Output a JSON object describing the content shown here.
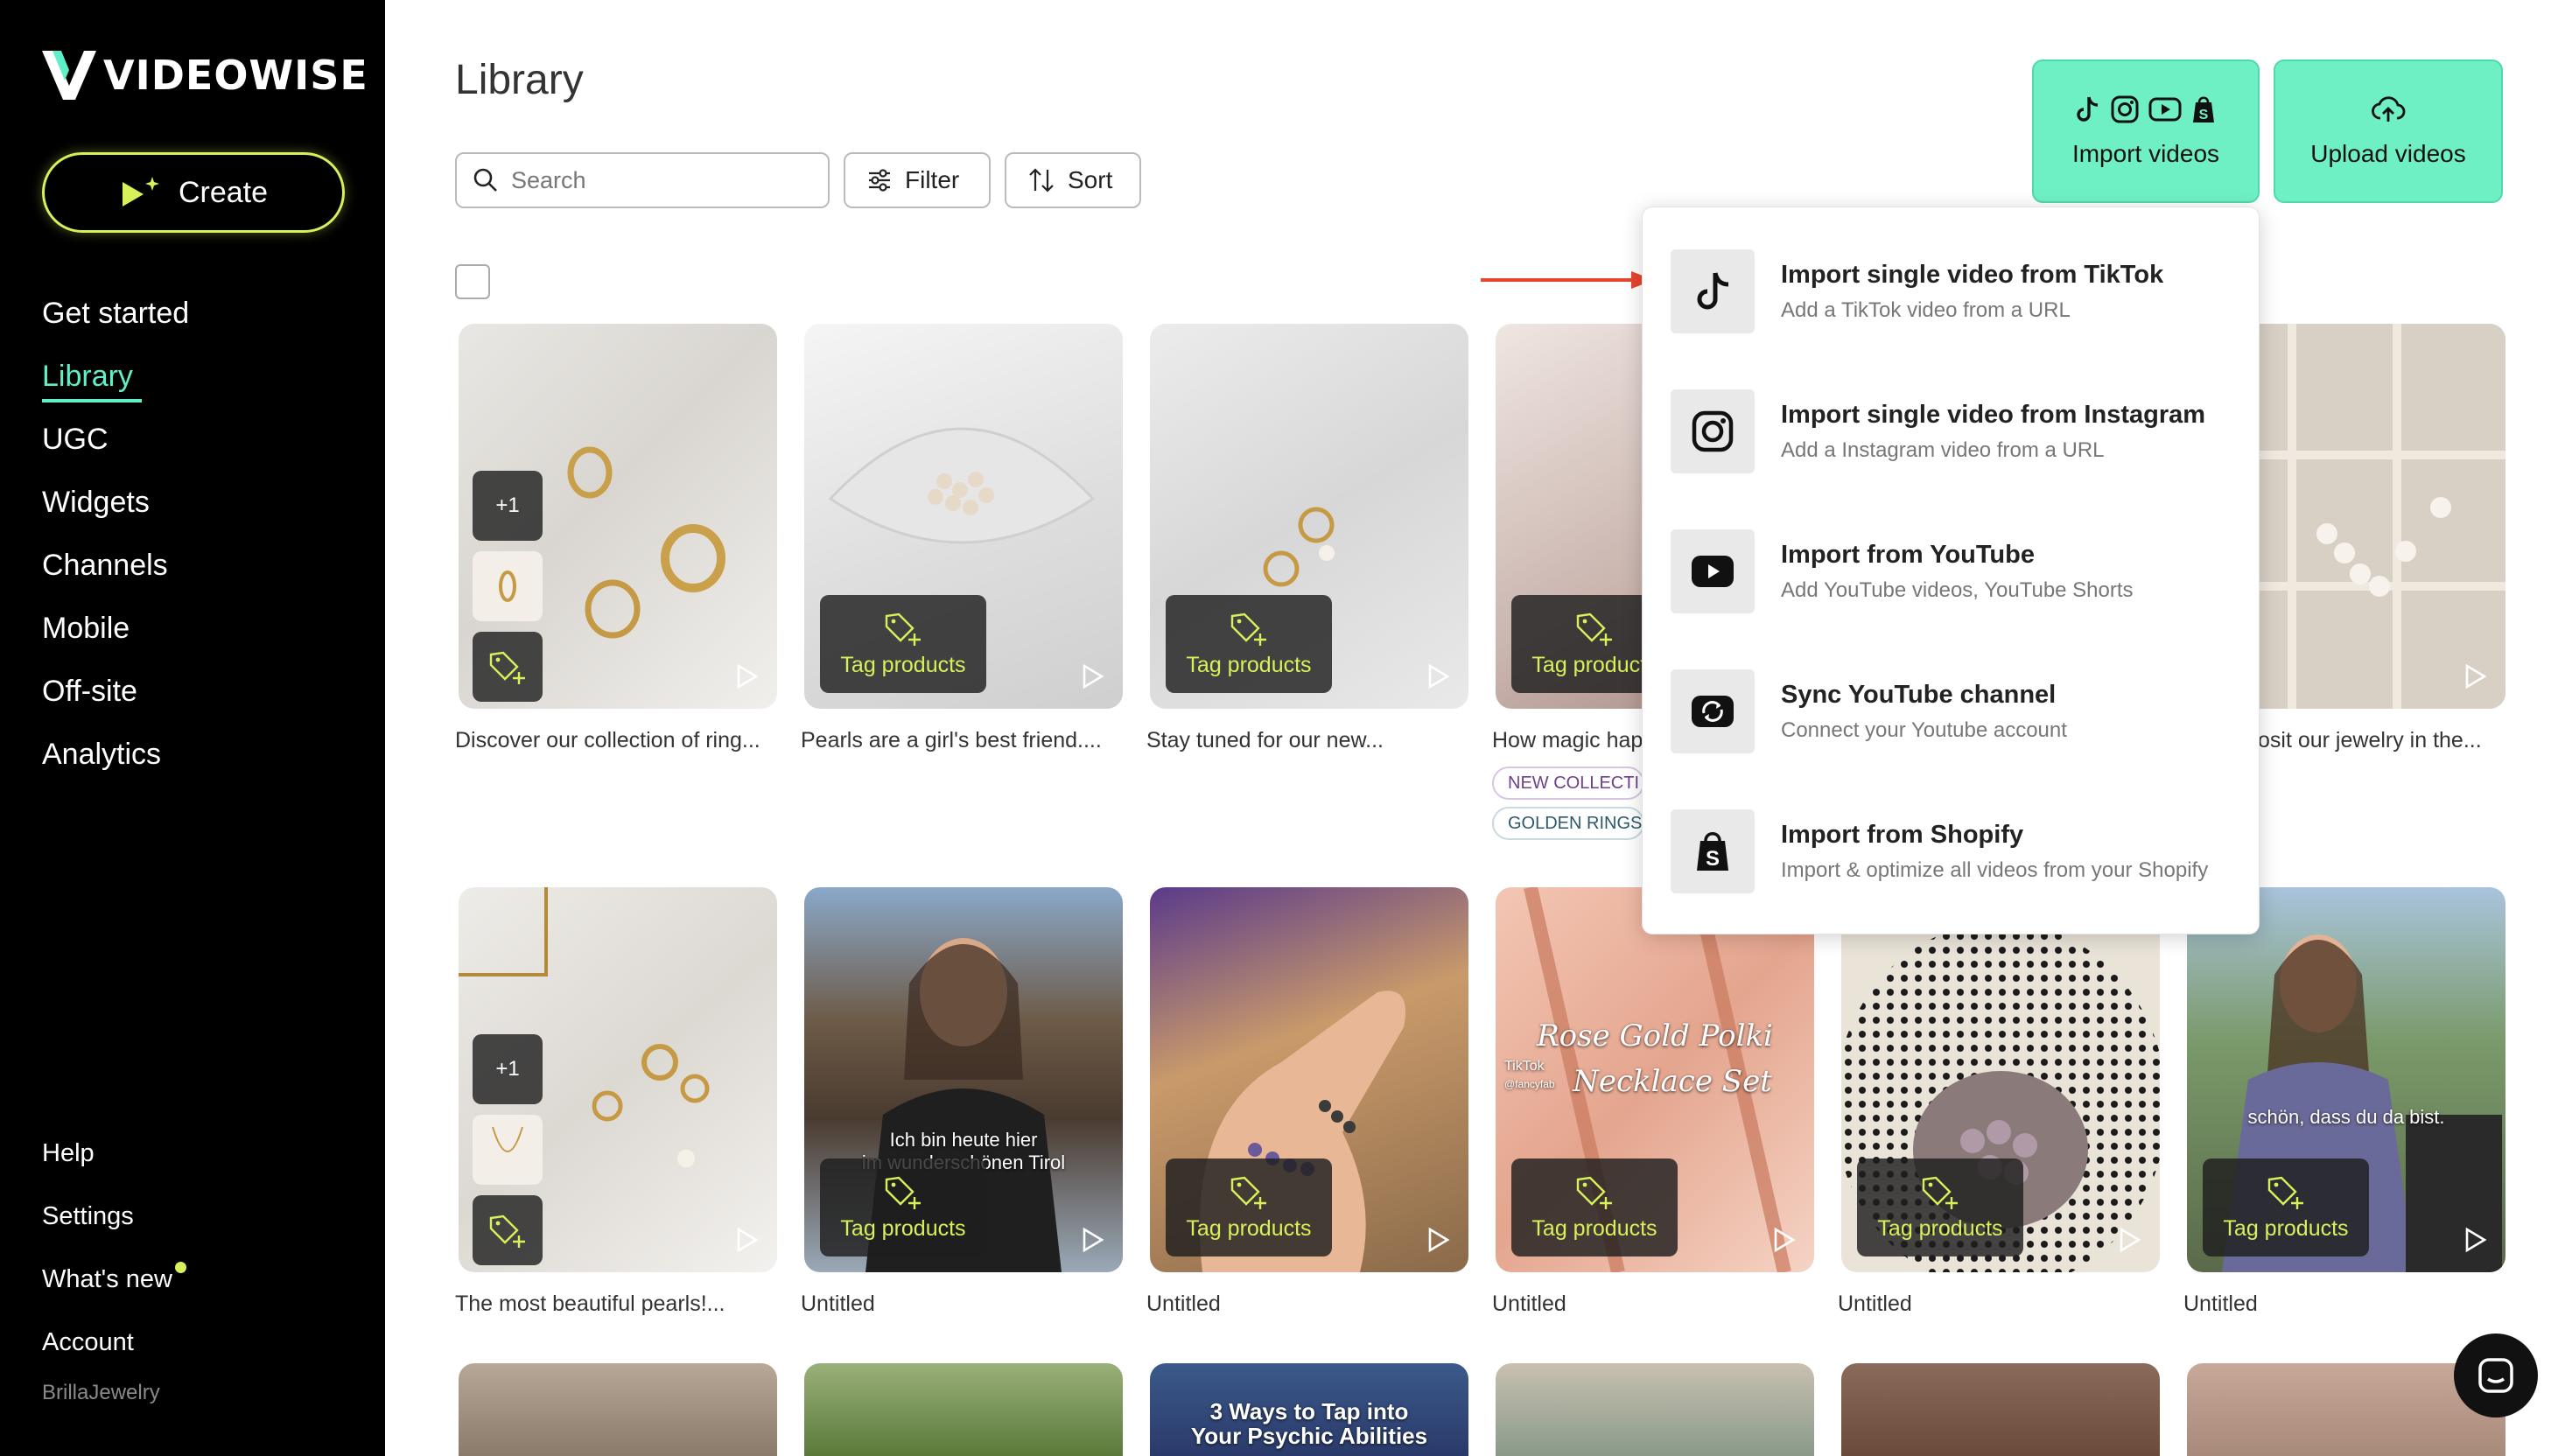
{
  "brand": {
    "name": "VIDEOWISE",
    "accent": "#d8f05a",
    "active_nav": "#5ff0c8",
    "button_bg": "#6ff0c4"
  },
  "sidebar": {
    "create_label": "Create",
    "nav": [
      "Get started",
      "Library",
      "UGC",
      "Widgets",
      "Channels",
      "Mobile",
      "Off-site",
      "Analytics"
    ],
    "active": "Library",
    "bottom": [
      "Help",
      "Settings",
      "What's new",
      "Account"
    ],
    "account_name": "BrillaJewelry"
  },
  "header": {
    "title": "Library",
    "search_placeholder": "Search",
    "filter_label": "Filter",
    "sort_label": "Sort",
    "import_label": "Import videos",
    "upload_label": "Upload videos"
  },
  "dropdown": {
    "items": [
      {
        "title": "Import single video from TikTok",
        "subtitle": "Add a TikTok video from a URL",
        "icon": "tiktok-icon"
      },
      {
        "title": "Import single video from Instagram",
        "subtitle": "Add a Instagram video from a URL",
        "icon": "instagram-icon"
      },
      {
        "title": "Import from YouTube",
        "subtitle": "Add YouTube videos, YouTube Shorts",
        "icon": "youtube-icon"
      },
      {
        "title": "Sync YouTube channel",
        "subtitle": "Connect your Youtube account",
        "icon": "sync-icon"
      },
      {
        "title": "Import from Shopify",
        "subtitle": "Import & optimize all videos from your Shopify",
        "icon": "shopify-icon"
      }
    ]
  },
  "videos": {
    "tag_label": "Tag products",
    "stack_count": "+1",
    "row1": [
      "Discover our collection of ring...",
      "Pearls are a girl's best friend....",
      "Stay tuned for our new...",
      "How magic hap",
      "",
      "osit our jewelry in the..."
    ],
    "row2": [
      "The most beautiful pearls!...",
      "Untitled",
      "Untitled",
      "Untitled",
      "Untitled",
      "Untitled"
    ],
    "tags": [
      "NEW COLLECTI",
      "GOLDEN RINGS"
    ],
    "overlays": {
      "tirol_1": "Ich bin heute hier",
      "tirol_2": "im wunderschönen Tirol",
      "polki_1": "Rose Gold Polki",
      "polki_2": "Necklace Set",
      "tiktok_mark": "TikTok",
      "tiktok_handle": "@fancyfab",
      "schoen": "schön, dass du da bist.",
      "psychic_1": "3 Ways to Tap into",
      "psychic_2": "Your Psychic Abilities"
    }
  }
}
